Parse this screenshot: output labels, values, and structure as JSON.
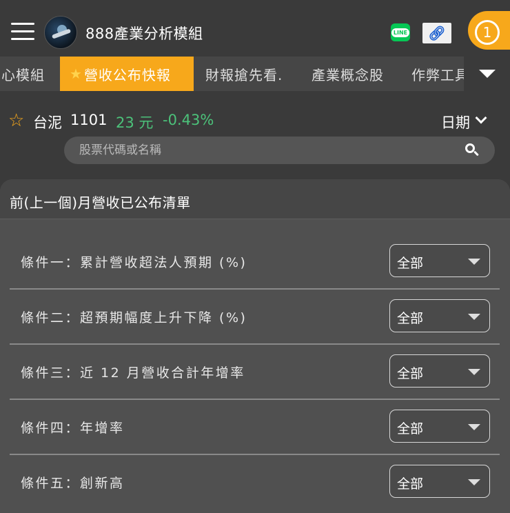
{
  "header": {
    "app_title": "888產業分析模組",
    "line_label": "LINE",
    "link_icon": "link-icon",
    "notification_count": "1"
  },
  "tabs": [
    {
      "label": "心模組",
      "active": false
    },
    {
      "label": "營收公布快報",
      "active": true,
      "icon": "star-icon"
    },
    {
      "label": "財報搶先看.",
      "active": false
    },
    {
      "label": "產業概念股",
      "active": false
    },
    {
      "label": "作弊工具",
      "active": false
    }
  ],
  "stock": {
    "name": "台泥",
    "code": "1101",
    "price": "23 元",
    "change": "-0.43%",
    "change_color": "#4cc27a",
    "date_label": "日期"
  },
  "search": {
    "placeholder": "股票代碼或名稱"
  },
  "panel": {
    "title": "前(上一個)月營收已公布清單",
    "conditions": [
      {
        "label": "條件一：累計營收超法人預期 (%)",
        "value": "全部"
      },
      {
        "label": "條件二：超預期幅度上升下降 (%)",
        "value": "全部"
      },
      {
        "label": "條件三：近 12 月營收合計年增率",
        "value": "全部"
      },
      {
        "label": "條件四：年增率",
        "value": "全部"
      },
      {
        "label": "條件五：創新高",
        "value": "全部"
      }
    ]
  },
  "colors": {
    "accent": "#f7a81b",
    "background": "#3a3a3a",
    "positive_green": "#4cc27a"
  }
}
